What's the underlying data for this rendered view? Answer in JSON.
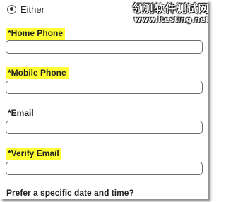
{
  "contact_preference": {
    "option_label": "Either"
  },
  "fields": {
    "home_phone": {
      "label": "*Home Phone",
      "value": "",
      "highlighted": true
    },
    "mobile_phone": {
      "label": "*Mobile Phone",
      "value": "",
      "highlighted": true
    },
    "email": {
      "label": "*Email",
      "value": "",
      "highlighted": false
    },
    "verify_email": {
      "label": "*Verify Email",
      "value": "",
      "highlighted": true
    }
  },
  "next_section": {
    "question": "Prefer a specific date and time?"
  },
  "watermark": {
    "title": "领测软件测试网",
    "url": "www.ltesting.net"
  },
  "colors": {
    "highlight": "#ffff33",
    "input_border": "#6d6d6d",
    "text": "#222222"
  }
}
